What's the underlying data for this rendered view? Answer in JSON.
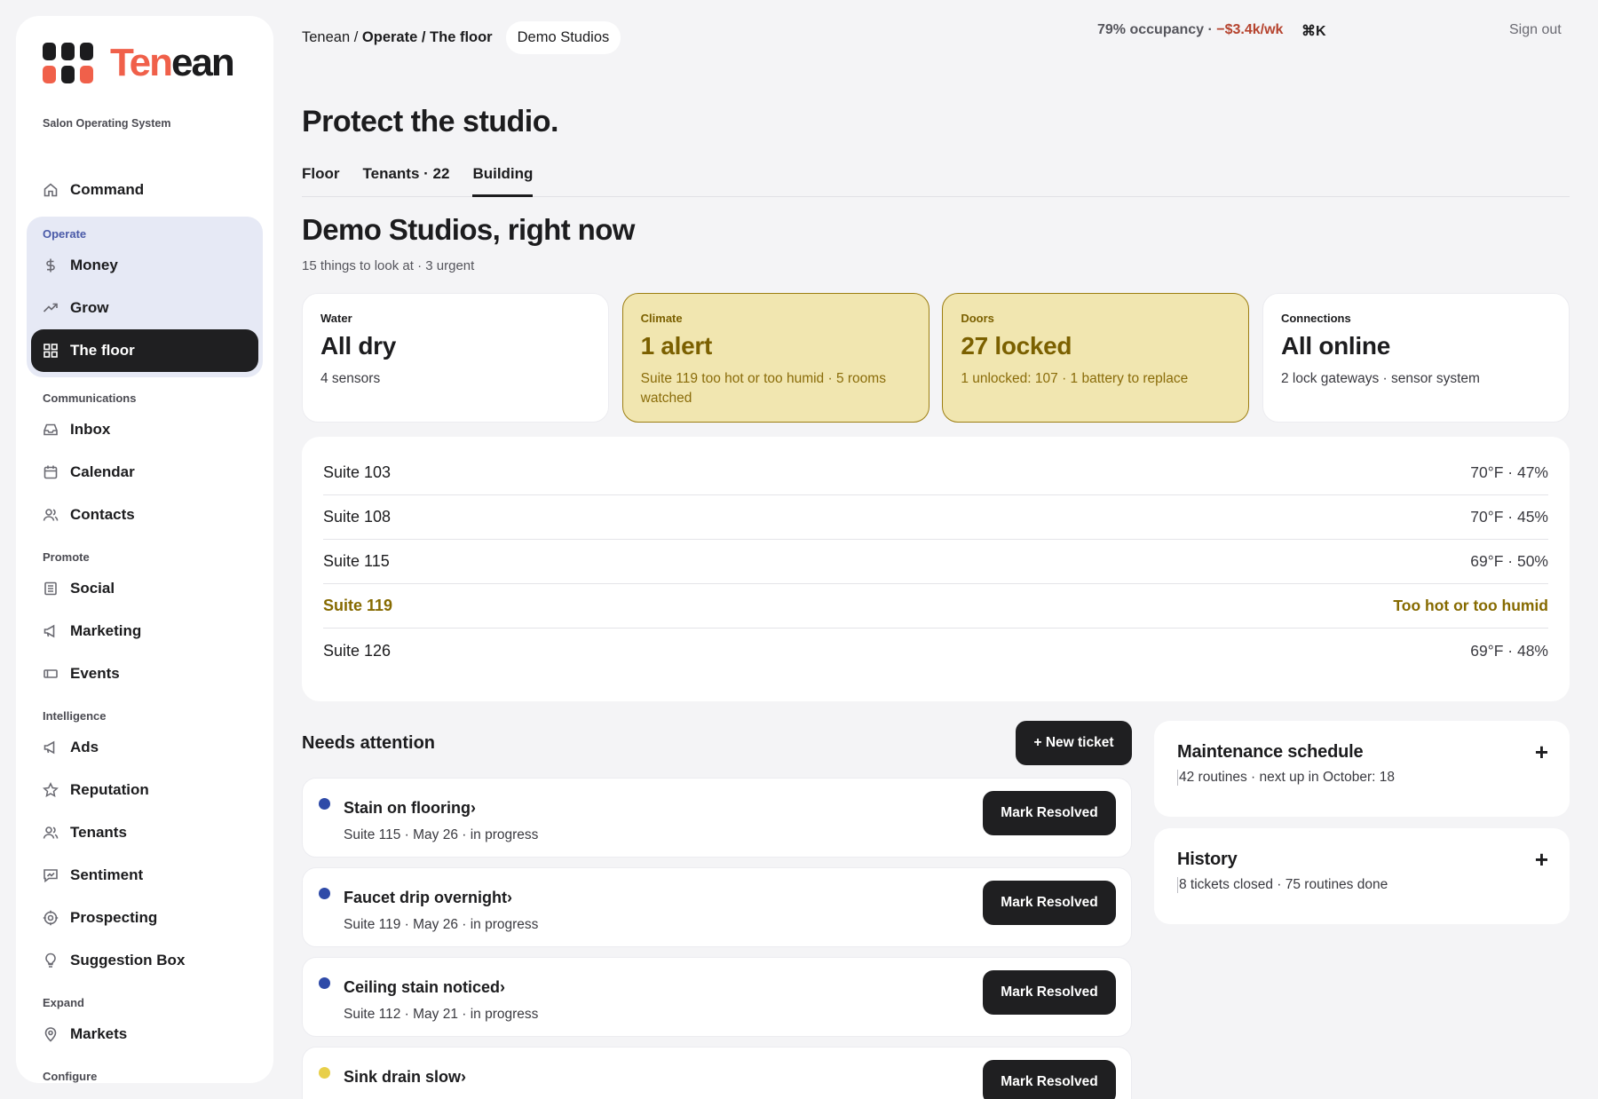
{
  "brand": {
    "name_accent": "Ten",
    "name_rest": "ean",
    "tagline": "Salon Operating System",
    "colors": {
      "accent": "#f0604a",
      "dark": "#1f1f21",
      "warn_bg": "#f1e6b0",
      "warn_text": "#7b6000",
      "active_group_bg": "#e6e9f5"
    }
  },
  "sidebar": {
    "top": {
      "label": "Command",
      "icon": "home-icon"
    },
    "groups": [
      {
        "label": "Operate",
        "items": [
          {
            "label": "Money",
            "icon": "dollar-icon"
          },
          {
            "label": "Grow",
            "icon": "trend-up-icon"
          },
          {
            "label": "The floor",
            "icon": "grid-icon"
          }
        ]
      },
      {
        "label": "Communications",
        "items": [
          {
            "label": "Inbox",
            "icon": "inbox-icon"
          },
          {
            "label": "Calendar",
            "icon": "calendar-icon"
          },
          {
            "label": "Contacts",
            "icon": "people-icon"
          }
        ]
      },
      {
        "label": "Promote",
        "items": [
          {
            "label": "Social",
            "icon": "document-icon"
          },
          {
            "label": "Marketing",
            "icon": "megaphone-icon"
          },
          {
            "label": "Events",
            "icon": "ticket-icon"
          }
        ]
      },
      {
        "label": "Intelligence",
        "items": [
          {
            "label": "Ads",
            "icon": "megaphone-icon"
          },
          {
            "label": "Reputation",
            "icon": "star-icon"
          },
          {
            "label": "Tenants",
            "icon": "people-icon"
          },
          {
            "label": "Sentiment",
            "icon": "chat-chart-icon"
          },
          {
            "label": "Prospecting",
            "icon": "target-icon"
          },
          {
            "label": "Suggestion Box",
            "icon": "lightbulb-icon"
          }
        ]
      },
      {
        "label": "Expand",
        "items": [
          {
            "label": "Markets",
            "icon": "location-pin-icon"
          }
        ]
      },
      {
        "label": "Configure",
        "items": []
      }
    ]
  },
  "topbar": {
    "crumb_root": "Tenean",
    "crumb_sep": " / ",
    "crumb_section": "Operate",
    "crumb_page": "The floor",
    "workspace": "Demo Studios",
    "occupancy": "79% occupancy · ",
    "loss": "−$3.4k/wk",
    "command_shortcut": "⌘K",
    "sign_out": "Sign out"
  },
  "page": {
    "title": "Protect the studio.",
    "tabs": [
      "Floor",
      "Tenants · 22",
      "Building"
    ],
    "section_title": "Demo Studios, right now",
    "summary": "15 things to look at · 3 urgent"
  },
  "status_cards": [
    {
      "label": "Water",
      "value": "All dry",
      "detail": "4 sensors"
    },
    {
      "label": "Climate",
      "value": "1 alert",
      "detail": "Suite 119 too hot or too humid · 5 rooms watched"
    },
    {
      "label": "Doors",
      "value": "27 locked",
      "detail": "1 unlocked: 107 · 1 battery to replace"
    },
    {
      "label": "Connections",
      "value": "All online",
      "detail": "2 lock gateways · sensor system"
    }
  ],
  "rooms": [
    {
      "name": "Suite 103",
      "reading": "70°F · 47%"
    },
    {
      "name": "Suite 108",
      "reading": "70°F · 45%"
    },
    {
      "name": "Suite 115",
      "reading": "69°F · 50%"
    },
    {
      "name": "Suite 119",
      "reading": "Too hot or too humid"
    },
    {
      "name": "Suite 126",
      "reading": "69°F · 48%"
    }
  ],
  "attention": {
    "title": "Needs attention",
    "new_ticket": "+ New ticket",
    "tickets": [
      {
        "title": "Stain on flooring›",
        "meta": "Suite 115 · May 26 · in progress",
        "action": "Mark Resolved",
        "dot_color": "#2e4aa8"
      },
      {
        "title": "Faucet drip overnight›",
        "meta": "Suite 119 · May 26 · in progress",
        "action": "Mark Resolved",
        "dot_color": "#2e4aa8"
      },
      {
        "title": "Ceiling stain noticed›",
        "meta": "Suite 112 · May 21 · in progress",
        "action": "Mark Resolved",
        "dot_color": "#2e4aa8"
      },
      {
        "title": "Sink drain slow›",
        "meta": "",
        "action": "Mark Resolved",
        "dot_color": "#e8cf4a"
      }
    ]
  },
  "side_panels": [
    {
      "title": "Maintenance schedule",
      "detail": "42 routines · next up in October: 18",
      "toggle": "+"
    },
    {
      "title": "History",
      "detail": "8 tickets closed · 75 routines done",
      "toggle": "+"
    }
  ]
}
